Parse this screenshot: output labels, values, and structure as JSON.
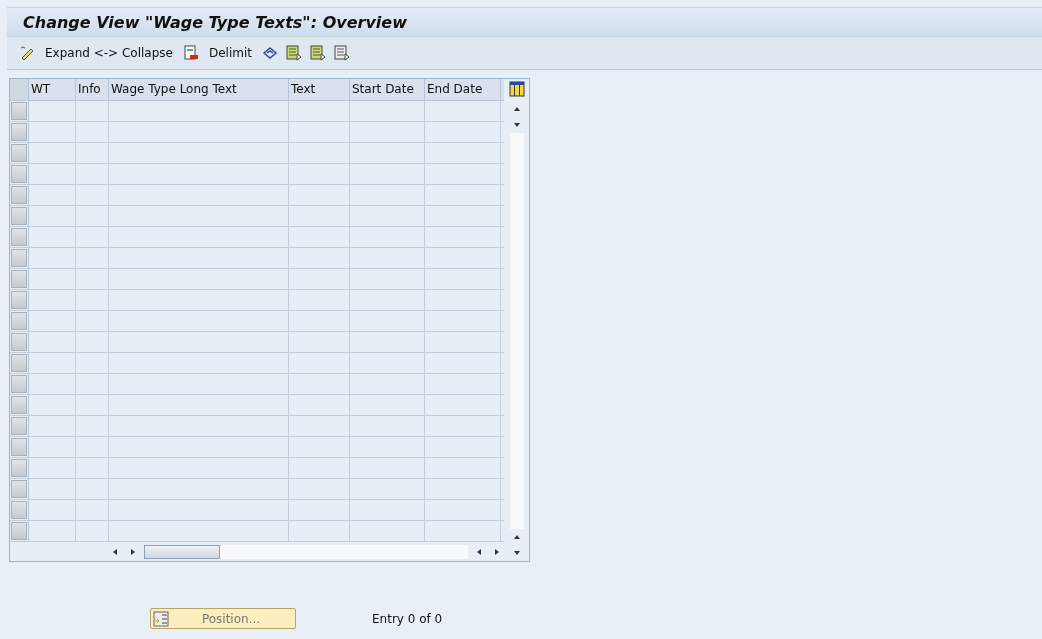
{
  "window": {
    "title": "Change View \"Wage Type Texts\": Overview"
  },
  "toolbar": [
    {
      "kind": "icon"
    },
    {
      "kind": "text",
      "label": "Expand <-> Collapse"
    },
    {
      "kind": "icon"
    },
    {
      "kind": "text",
      "label": "Delimit"
    },
    {
      "kind": "icon"
    },
    {
      "kind": "icon"
    },
    {
      "kind": "icon"
    },
    {
      "kind": "icon"
    }
  ],
  "table": {
    "columns": [
      "WT",
      "Info",
      "Wage Type Long Text",
      "Text",
      "Start Date",
      "End Date"
    ]
  },
  "footer": {
    "position_button": "Position...",
    "entry_count": "Entry 0 of 0"
  }
}
